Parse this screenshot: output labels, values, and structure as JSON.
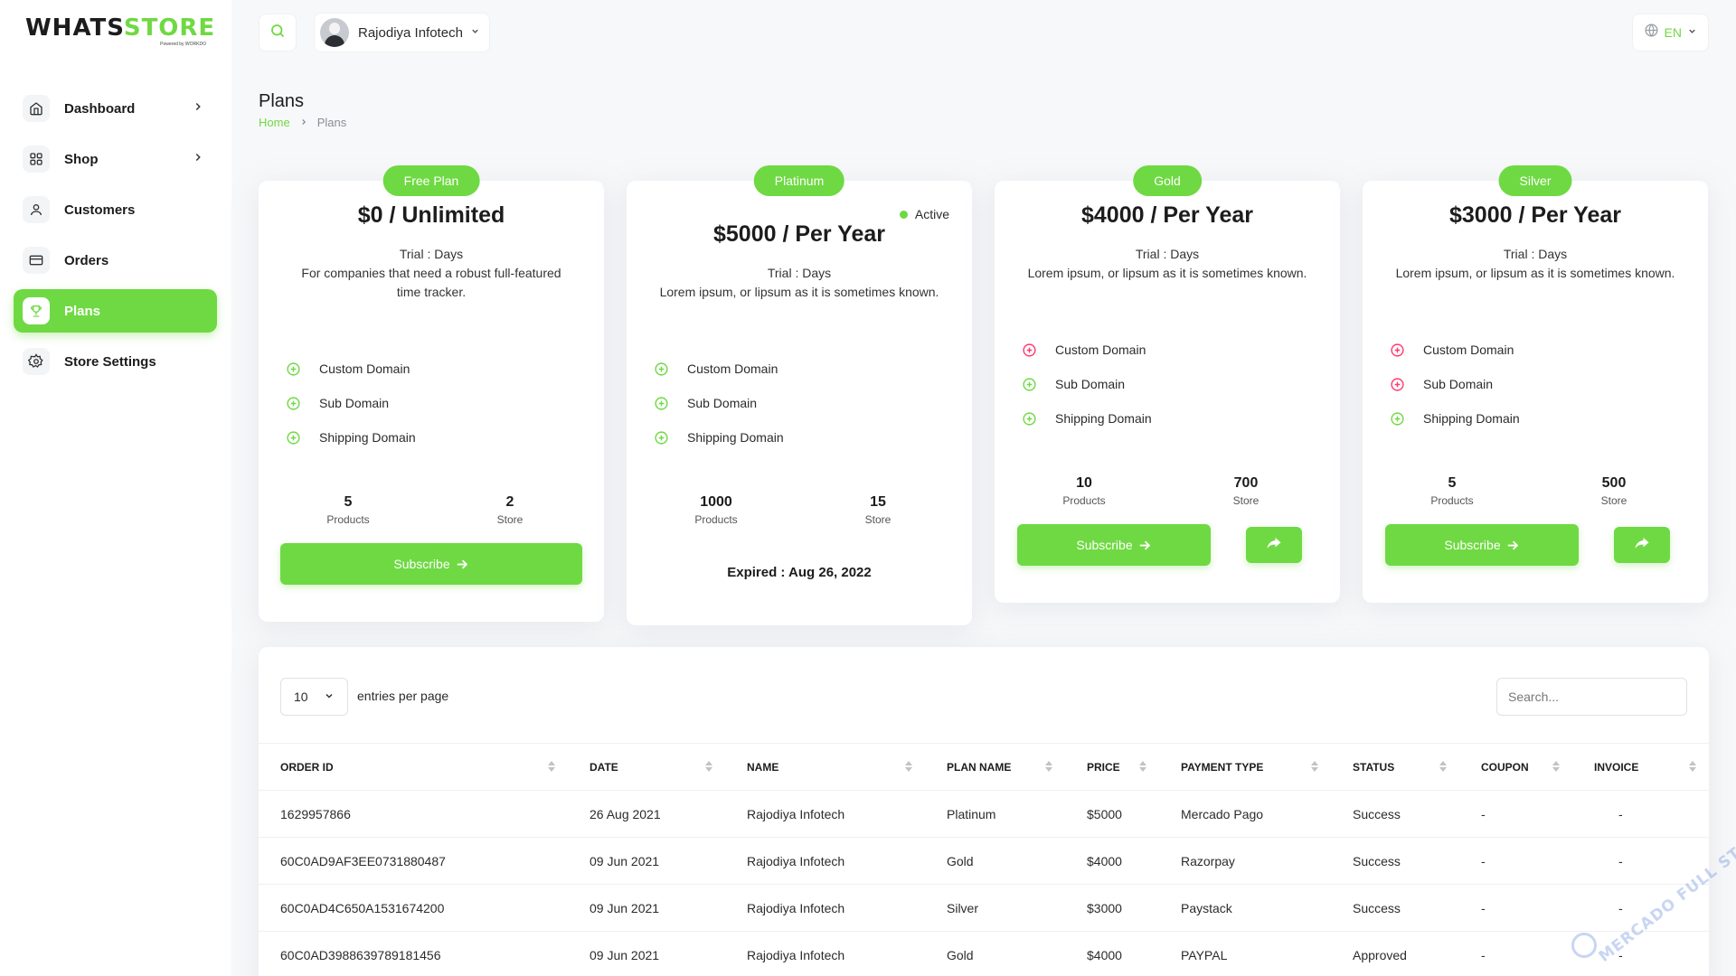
{
  "app": {
    "logo_text_a": "WHATS",
    "logo_text_b": "STORE",
    "logo_sub": "Powered by WORKDO",
    "accent_color": "#6fd943",
    "danger_color": "#ff3a6e"
  },
  "sidebar": {
    "items": [
      {
        "label": "Dashboard",
        "icon": "home-icon",
        "has_chevron": true,
        "active": false
      },
      {
        "label": "Shop",
        "icon": "grid-icon",
        "has_chevron": true,
        "active": false
      },
      {
        "label": "Customers",
        "icon": "user-icon",
        "has_chevron": false,
        "active": false
      },
      {
        "label": "Orders",
        "icon": "credit-card-icon",
        "has_chevron": false,
        "active": false
      },
      {
        "label": "Plans",
        "icon": "trophy-icon",
        "has_chevron": false,
        "active": true
      },
      {
        "label": "Store Settings",
        "icon": "settings-icon",
        "has_chevron": false,
        "active": false
      }
    ]
  },
  "header": {
    "user_name": "Rajodiya Infotech",
    "language": "EN"
  },
  "page": {
    "title": "Plans",
    "breadcrumb_home": "Home",
    "breadcrumb_current": "Plans"
  },
  "plans": [
    {
      "badge": "Free Plan",
      "price": "$0 / Unlimited",
      "trial": "Trial : Days",
      "description": "For companies that need a robust full-featured time tracker.",
      "features": [
        {
          "label": "Custom Domain",
          "enabled": true
        },
        {
          "label": "Sub Domain",
          "enabled": true
        },
        {
          "label": "Shipping Domain",
          "enabled": true
        }
      ],
      "products": "5",
      "products_label": "Products",
      "stores": "2",
      "stores_label": "Store",
      "subscribe_label": "Subscribe"
    },
    {
      "badge": "Platinum",
      "active_label": "Active",
      "price": "$5000 / Per Year",
      "trial": "Trial : Days",
      "description": "Lorem ipsum, or lipsum as it is sometimes known.",
      "features": [
        {
          "label": "Custom Domain",
          "enabled": true
        },
        {
          "label": "Sub Domain",
          "enabled": true
        },
        {
          "label": "Shipping Domain",
          "enabled": true
        }
      ],
      "products": "1000",
      "products_label": "Products",
      "stores": "15",
      "stores_label": "Store",
      "expired": "Expired : Aug 26, 2022"
    },
    {
      "badge": "Gold",
      "price": "$4000 / Per Year",
      "trial": "Trial : Days",
      "description": "Lorem ipsum, or lipsum as it is sometimes known.",
      "features": [
        {
          "label": "Custom Domain",
          "enabled": false
        },
        {
          "label": "Sub Domain",
          "enabled": true
        },
        {
          "label": "Shipping Domain",
          "enabled": true
        }
      ],
      "products": "10",
      "products_label": "Products",
      "stores": "700",
      "stores_label": "Store",
      "subscribe_label": "Subscribe"
    },
    {
      "badge": "Silver",
      "price": "$3000 / Per Year",
      "trial": "Trial : Days",
      "description": "Lorem ipsum, or lipsum as it is sometimes known.",
      "features": [
        {
          "label": "Custom Domain",
          "enabled": false
        },
        {
          "label": "Sub Domain",
          "enabled": false
        },
        {
          "label": "Shipping Domain",
          "enabled": true
        }
      ],
      "products": "5",
      "products_label": "Products",
      "stores": "500",
      "stores_label": "Store",
      "subscribe_label": "Subscribe"
    }
  ],
  "orders_table": {
    "entries_value": "10",
    "entries_label": "entries per page",
    "search_placeholder": "Search...",
    "columns": [
      "ORDER ID",
      "DATE",
      "NAME",
      "PLAN NAME",
      "PRICE",
      "PAYMENT TYPE",
      "STATUS",
      "COUPON",
      "INVOICE"
    ],
    "rows": [
      [
        "1629957866",
        "26 Aug 2021",
        "Rajodiya Infotech",
        "Platinum",
        "$5000",
        "Mercado Pago",
        "Success",
        "-",
        "-"
      ],
      [
        "60C0AD9AF3EE0731880487",
        "09 Jun 2021",
        "Rajodiya Infotech",
        "Gold",
        "$4000",
        "Razorpay",
        "Success",
        "-",
        "-"
      ],
      [
        "60C0AD4C650A1531674200",
        "09 Jun 2021",
        "Rajodiya Infotech",
        "Silver",
        "$3000",
        "Paystack",
        "Success",
        "-",
        "-"
      ],
      [
        "60C0AD3988639789181456",
        "09 Jun 2021",
        "Rajodiya Infotech",
        "Gold",
        "$4000",
        "PAYPAL",
        "Approved",
        "-",
        "-"
      ]
    ]
  },
  "watermark": {
    "text": "MERCADO FULL STACK"
  }
}
